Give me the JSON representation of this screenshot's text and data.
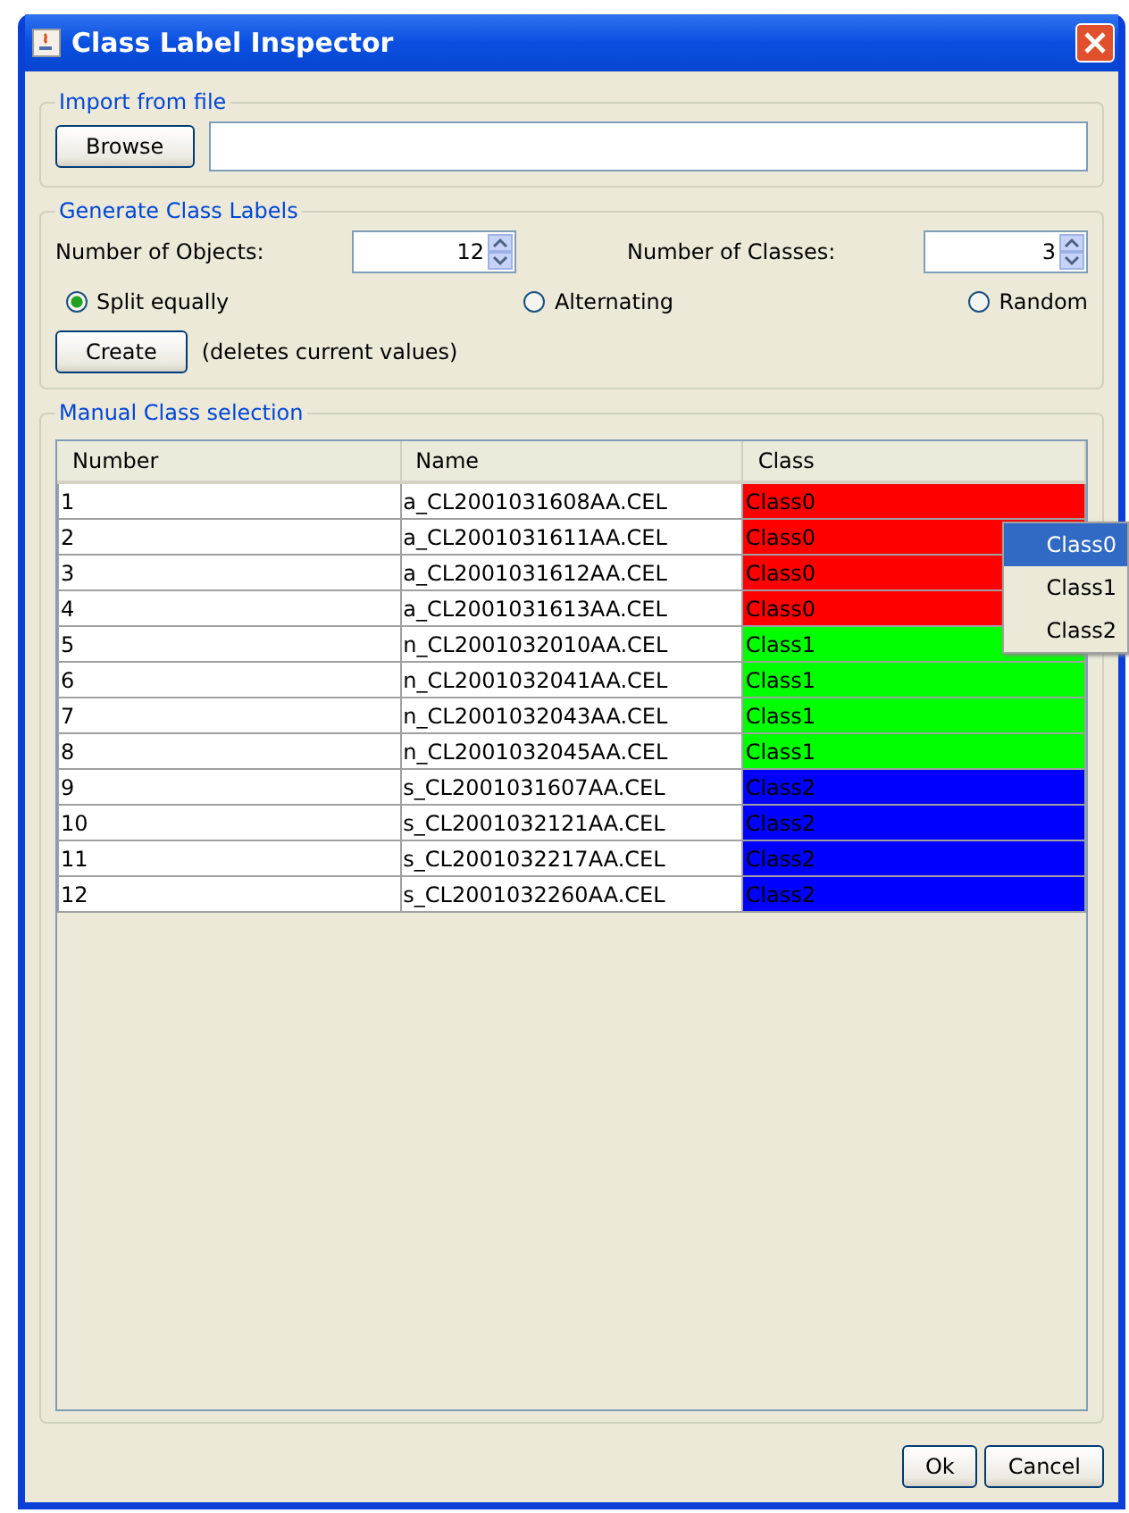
{
  "window": {
    "title": "Class Label Inspector"
  },
  "import_group": {
    "title": "Import from file",
    "browse_button": "Browse"
  },
  "generate_group": {
    "title": "Generate Class Labels",
    "objects": {
      "label": "Number of Objects:",
      "value": "12"
    },
    "classes": {
      "label": "Number of Classes:",
      "value": "3"
    },
    "modes": [
      {
        "label": "Split equally",
        "selected": true
      },
      {
        "label": "Alternating",
        "selected": false
      },
      {
        "label": "Random",
        "selected": false
      }
    ],
    "create_button": "Create",
    "create_note": "(deletes current values)"
  },
  "manual_group": {
    "title": "Manual Class selection",
    "table": {
      "columns": [
        "Number",
        "Name",
        "Class"
      ],
      "rows": [
        {
          "number": "1",
          "name": "a_CL2001031608AA.CEL",
          "class": "Class0",
          "color": "#ff0000"
        },
        {
          "number": "2",
          "name": "a_CL2001031611AA.CEL",
          "class": "Class0",
          "color": "#ff0000"
        },
        {
          "number": "3",
          "name": "a_CL2001031612AA.CEL",
          "class": "Class0",
          "color": "#ff0000"
        },
        {
          "number": "4",
          "name": "a_CL2001031613AA.CEL",
          "class": "Class0",
          "color": "#ff0000"
        },
        {
          "number": "5",
          "name": "n_CL2001032010AA.CEL",
          "class": "Class1",
          "color": "#00ff00"
        },
        {
          "number": "6",
          "name": "n_CL2001032041AA.CEL",
          "class": "Class1",
          "color": "#00ff00"
        },
        {
          "number": "7",
          "name": "n_CL2001032043AA.CEL",
          "class": "Class1",
          "color": "#00ff00"
        },
        {
          "number": "8",
          "name": "n_CL2001032045AA.CEL",
          "class": "Class1",
          "color": "#00ff00"
        },
        {
          "number": "9",
          "name": "s_CL2001031607AA.CEL",
          "class": "Class2",
          "color": "#0000ff"
        },
        {
          "number": "10",
          "name": "s_CL2001032121AA.CEL",
          "class": "Class2",
          "color": "#0000ff"
        },
        {
          "number": "11",
          "name": "s_CL2001032217AA.CEL",
          "class": "Class2",
          "color": "#0000ff"
        },
        {
          "number": "12",
          "name": "s_CL2001032260AA.CEL",
          "class": "Class2",
          "color": "#0000ff"
        }
      ]
    },
    "dropdown": [
      {
        "label": "Class0",
        "selected": true
      },
      {
        "label": "Class1",
        "selected": false
      },
      {
        "label": "Class2",
        "selected": false
      }
    ]
  },
  "buttons": [
    "Ok",
    "Cancel"
  ]
}
